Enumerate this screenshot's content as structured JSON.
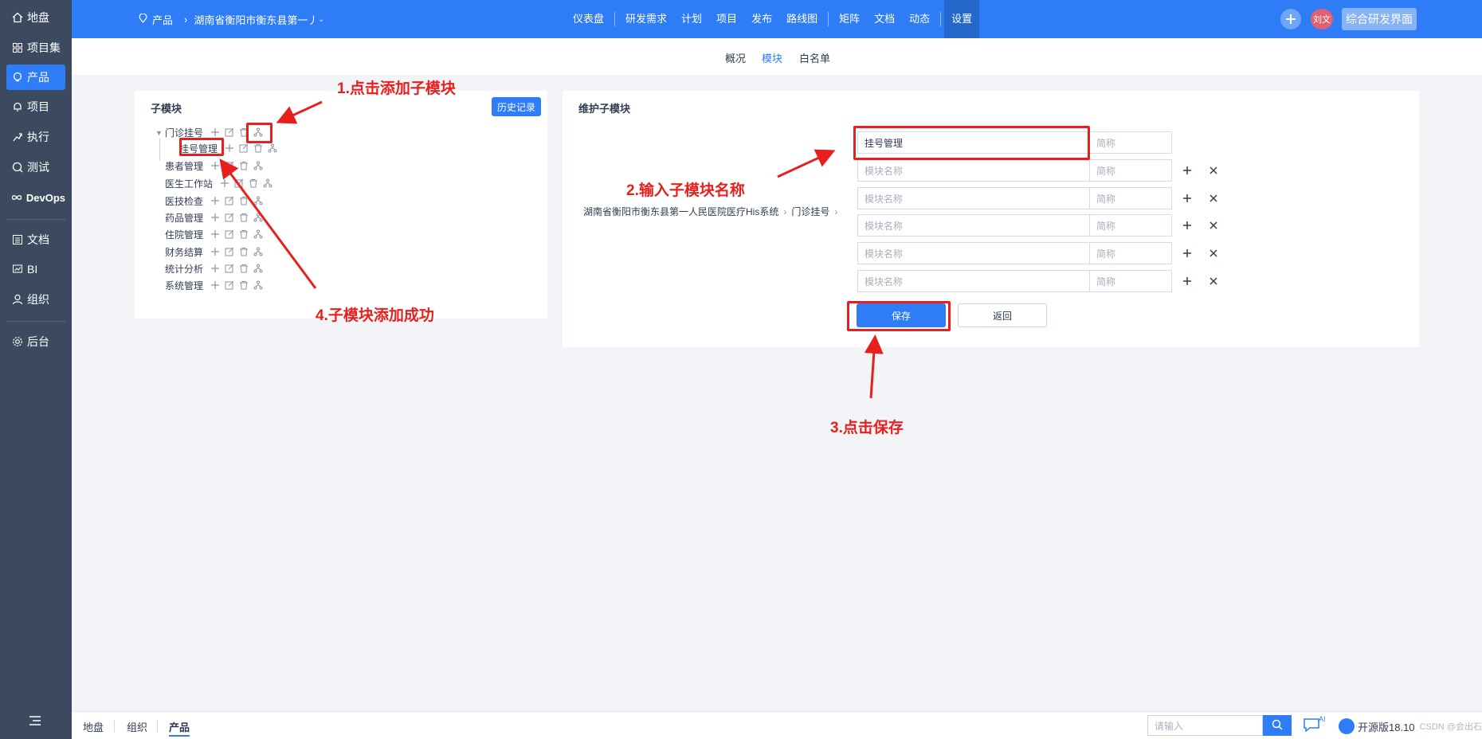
{
  "sidebar": {
    "items": [
      {
        "label": "地盘",
        "icon": "home-icon"
      },
      {
        "label": "项目集",
        "icon": "grid-icon"
      },
      {
        "label": "产品",
        "icon": "lightbulb-icon"
      },
      {
        "label": "项目",
        "icon": "bell-icon"
      },
      {
        "label": "执行",
        "icon": "run-icon"
      },
      {
        "label": "测试",
        "icon": "search-circle-icon"
      },
      {
        "label": "DevOps",
        "icon": "infinity-icon"
      },
      {
        "label": "文档",
        "icon": "list-icon"
      },
      {
        "label": "BI",
        "icon": "chart-icon"
      },
      {
        "label": "组织",
        "icon": "user-icon"
      },
      {
        "label": "后台",
        "icon": "gear-icon"
      }
    ]
  },
  "topbar": {
    "breadcrumb_root": "产品",
    "breadcrumb_product": "湖南省衡阳市衡东县第一丿",
    "nav": [
      "仪表盘",
      "研发需求",
      "计划",
      "项目",
      "发布",
      "路线图",
      "矩阵",
      "文档",
      "动态",
      "设置"
    ],
    "avatar": "刘文",
    "synth_button": "综合研发界面"
  },
  "subtabs": [
    "概况",
    "模块",
    "白名单"
  ],
  "left_card": {
    "title": "子模块",
    "history_button": "历史记录",
    "tree": [
      "门诊挂号",
      "挂号管理",
      "患者管理",
      "医生工作站",
      "医技检查",
      "药品管理",
      "住院管理",
      "财务结算",
      "统计分析",
      "系统管理"
    ]
  },
  "right_card": {
    "title": "维护子模块",
    "path_product": "湖南省衡阳市衡东县第一人民医院医疗His系统",
    "path_module": "门诊挂号",
    "first_name_value": "挂号管理",
    "name_placeholder": "模块名称",
    "short_placeholder": "简称",
    "save_button": "保存",
    "back_button": "返回"
  },
  "annotations": {
    "step1": "1.点击添加子模块",
    "step2": "2.输入子模块名称",
    "step3": "3.点击保存",
    "step4": "4.子模块添加成功",
    "color": "#e8201d"
  },
  "bottombar": {
    "tabs": [
      "地盘",
      "组织",
      "产品"
    ],
    "search_placeholder": "请输入",
    "chat_badge": "AI",
    "version": "开源版18.10",
    "watermark": "CSDN @会出石"
  },
  "colors": {
    "primary": "#2e7cf6",
    "sidebar": "#3b4a5f",
    "background": "#f2f4f7"
  }
}
